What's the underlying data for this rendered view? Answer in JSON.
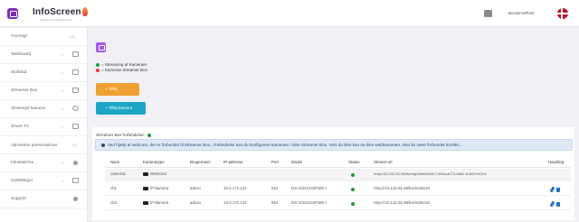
{
  "brand": {
    "name": "InfoScreen",
    "tagline": "Powered by InfoPoint ApS"
  },
  "header": {
    "user_name": "BoHolmstPost"
  },
  "sidebar": {
    "items": [
      {
        "label": "Oversigt",
        "chevron": "",
        "count": "(1)"
      },
      {
        "label": "Taskboard",
        "chevron": "<",
        "icon": "box"
      },
      {
        "label": "Slutblad",
        "chevron": "<",
        "icon": "box"
      },
      {
        "label": "Streamer Box",
        "chevron": "<",
        "icon": "box"
      },
      {
        "label": "Strømspil-kamera",
        "chevron": "<",
        "icon": "circle"
      },
      {
        "label": "Smart TV",
        "chevron": "<",
        "icon": "box"
      },
      {
        "label": "Administrer præsentationer",
        "chevron": "<",
        "count": "(1)"
      },
      {
        "label": "Infoskærme",
        "chevron": "<",
        "icon": "dot"
      },
      {
        "label": "Indstillinger",
        "chevron": "<",
        "icon": "box"
      },
      {
        "label": "Support",
        "chevron": "",
        "icon": "dot"
      }
    ]
  },
  "legend": {
    "online": "= Streaming af Kameraer",
    "offline": "= Kamerae Streamer Box"
  },
  "buttons": {
    "add": "+ Tilføj",
    "add_camera": "+ Tilføj kamera"
  },
  "panel": {
    "status": "Streamer Box forbindelse:",
    "info": "Ved hjælp af webcam, der er forbundet til Streamer Box, i forbindelse kan du konfigurere kameraer i dine Streamer Box. Hvis du ikke kan se dine webkameraer, skal du være forbundet korrekt...",
    "headers": [
      "Navn",
      "Kameratype",
      "Brugernavn",
      "IP-adresse",
      "Port",
      "Model",
      "Status",
      "Stream-url",
      "Handling"
    ],
    "rows": [
      {
        "name": "camera1",
        "type": "WebCam",
        "user": "",
        "ip": "",
        "port": "",
        "model": "",
        "url": "rtmp://10.132.91.68/live/dg3b6e5d04e7-5e5a-a073-e681-f14b37e41bc"
      },
      {
        "name": "cb1",
        "type": "IP-kamera",
        "user": "admin",
        "ip": "10.0.172.131",
        "port": "554",
        "model": "DS-2CD2142FWD-I",
        "url": "rtmp://10.132.91.68/live/e29418"
      },
      {
        "name": "cb2",
        "type": "IP-kamera",
        "user": "admin",
        "ip": "10.0.172.132",
        "port": "554",
        "model": "DS-2CD2142FWD-I",
        "url": "rtmp://10.132.91.68/live/e29419"
      }
    ]
  },
  "colors": {
    "accent": "#a855f7",
    "orange": "#f0a030",
    "teal": "#1aa6c4",
    "status_ok": "#1a9c3a",
    "status_off": "#e63946"
  }
}
